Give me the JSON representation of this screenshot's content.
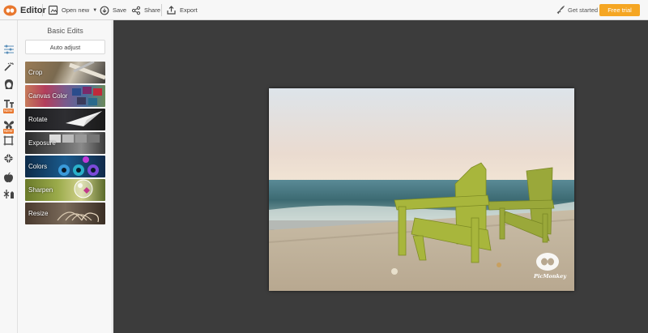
{
  "header": {
    "app_title": "Editor",
    "open_new_label": "Open new",
    "save_label": "Save",
    "share_label": "Share",
    "export_label": "Export",
    "get_started_label": "Get started",
    "free_trial_label": "Free trial"
  },
  "rail": {
    "items": [
      {
        "icon": "sliders-icon",
        "active": true
      },
      {
        "icon": "magic-wand-icon"
      },
      {
        "icon": "face-icon"
      },
      {
        "icon": "text-icon",
        "badge": "NEW"
      },
      {
        "icon": "butterfly-icon",
        "badge": "NEW"
      },
      {
        "icon": "frame-icon"
      },
      {
        "icon": "texture-icon"
      },
      {
        "icon": "apple-icon"
      },
      {
        "icon": "seasonal-icon"
      }
    ]
  },
  "panel": {
    "title": "Basic Edits",
    "auto_adjust_label": "Auto adjust",
    "tools": [
      {
        "label": "Crop"
      },
      {
        "label": "Canvas Color"
      },
      {
        "label": "Rotate"
      },
      {
        "label": "Exposure"
      },
      {
        "label": "Colors"
      },
      {
        "label": "Sharpen"
      },
      {
        "label": "Resize"
      }
    ]
  },
  "canvas": {
    "watermark_text": "PicMonkey"
  },
  "colors": {
    "accent": "#f5a623",
    "canvas_bg": "#3c3c3c"
  }
}
